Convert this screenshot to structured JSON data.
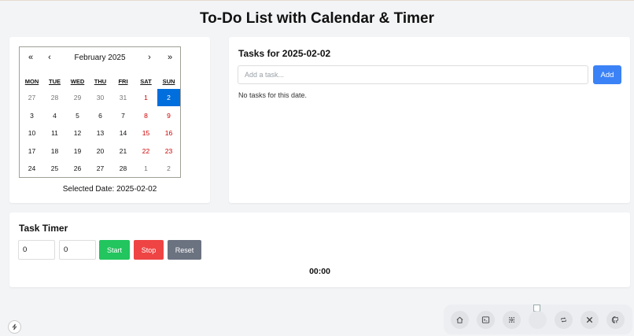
{
  "page": {
    "title": "To-Do List with Calendar & Timer"
  },
  "calendar": {
    "nav": {
      "prev_year": "«",
      "prev_month": "‹",
      "next_month": "›",
      "next_year": "»"
    },
    "month_label": "February 2025",
    "weekdays": [
      "MON",
      "TUE",
      "WED",
      "THU",
      "FRI",
      "SAT",
      "SUN"
    ],
    "weeks": [
      [
        {
          "d": "27",
          "t": "other"
        },
        {
          "d": "28",
          "t": "other"
        },
        {
          "d": "29",
          "t": "other"
        },
        {
          "d": "30",
          "t": "other"
        },
        {
          "d": "31",
          "t": "other"
        },
        {
          "d": "1",
          "t": "weekend"
        },
        {
          "d": "2",
          "t": "selected"
        }
      ],
      [
        {
          "d": "3",
          "t": ""
        },
        {
          "d": "4",
          "t": ""
        },
        {
          "d": "5",
          "t": ""
        },
        {
          "d": "6",
          "t": ""
        },
        {
          "d": "7",
          "t": ""
        },
        {
          "d": "8",
          "t": "weekend"
        },
        {
          "d": "9",
          "t": "weekend"
        }
      ],
      [
        {
          "d": "10",
          "t": ""
        },
        {
          "d": "11",
          "t": ""
        },
        {
          "d": "12",
          "t": ""
        },
        {
          "d": "13",
          "t": ""
        },
        {
          "d": "14",
          "t": ""
        },
        {
          "d": "15",
          "t": "weekend"
        },
        {
          "d": "16",
          "t": "weekend"
        }
      ],
      [
        {
          "d": "17",
          "t": ""
        },
        {
          "d": "18",
          "t": ""
        },
        {
          "d": "19",
          "t": ""
        },
        {
          "d": "20",
          "t": ""
        },
        {
          "d": "21",
          "t": ""
        },
        {
          "d": "22",
          "t": "weekend"
        },
        {
          "d": "23",
          "t": "weekend"
        }
      ],
      [
        {
          "d": "24",
          "t": ""
        },
        {
          "d": "25",
          "t": ""
        },
        {
          "d": "26",
          "t": ""
        },
        {
          "d": "27",
          "t": ""
        },
        {
          "d": "28",
          "t": ""
        },
        {
          "d": "1",
          "t": "other"
        },
        {
          "d": "2",
          "t": "other"
        }
      ]
    ],
    "selected_date_text": "Selected Date: 2025-02-02"
  },
  "tasks": {
    "title": "Tasks for 2025-02-02",
    "input_placeholder": "Add a task...",
    "add_label": "Add",
    "empty_message": "No tasks for this date."
  },
  "timer": {
    "title": "Task Timer",
    "minutes_value": "0",
    "seconds_value": "0",
    "start_label": "Start",
    "stop_label": "Stop",
    "reset_label": "Reset",
    "display": "00:00"
  },
  "colors": {
    "accent_blue": "#3b82f6",
    "selected_day": "#006edc",
    "weekend_red": "#d10000",
    "start_green": "#22c55e",
    "stop_red": "#ef4444",
    "reset_gray": "#6b7280"
  },
  "dock": {
    "icons": [
      "home-icon",
      "terminal-icon",
      "grid-icon",
      "avatar",
      "repeat-icon",
      "x-logo-icon",
      "github-icon"
    ]
  }
}
